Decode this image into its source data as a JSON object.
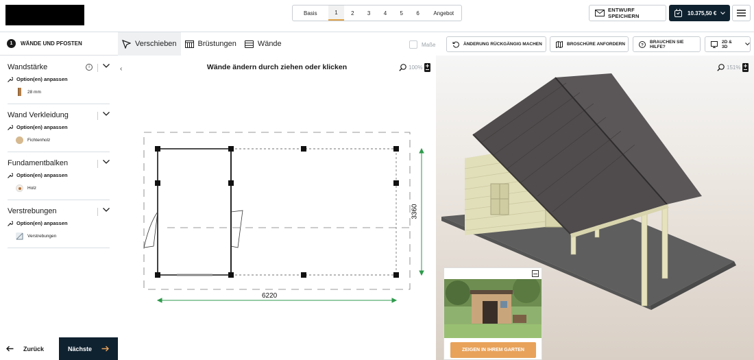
{
  "topbar": {
    "steps": [
      {
        "label": "Basis"
      },
      {
        "label": "1"
      },
      {
        "label": "2"
      },
      {
        "label": "3"
      },
      {
        "label": "4"
      },
      {
        "label": "5"
      },
      {
        "label": "6"
      },
      {
        "label": "Angebot"
      }
    ],
    "active_step": "1",
    "save_label": "ENTWURF SPEICHERN",
    "price_label": "10.375,50 €"
  },
  "stepbar": {
    "number": "1",
    "title": "WÄNDE UND PFOSTEN"
  },
  "tabs": [
    {
      "label": "Verschieben",
      "icon": "cursor-icon",
      "active": true
    },
    {
      "label": "Brüstungen",
      "icon": "railing-icon",
      "active": false
    },
    {
      "label": "Wände",
      "icon": "wall-icon",
      "active": false
    }
  ],
  "tools": {
    "masse_label": "Maße",
    "undo_label": "ÄNDERUNG RÜCKGÄNGIG MACHEN",
    "brochure_label": "BROSCHÜRE ANFORDERN",
    "help_label": "BRAUCHEN SIE HILFE?",
    "view_mode_label": "2D & 3D"
  },
  "sidebar": {
    "sections": [
      {
        "title": "Wandstärke",
        "option_label": "Option(en) anpassen",
        "value": "28 mm",
        "has_info": true
      },
      {
        "title": "Wand Verkleidung",
        "option_label": "Option(en) anpassen",
        "value": "Fichtenholz",
        "has_info": false
      },
      {
        "title": "Fundamentbalken",
        "option_label": "Option(en) anpassen",
        "value": "Holz",
        "has_info": false
      },
      {
        "title": "Verstrebungen",
        "option_label": "Option(en) anpassen",
        "value": "Verstrebungen",
        "has_info": false
      }
    ]
  },
  "plan": {
    "title": "Wände ändern durch ziehen oder klicken",
    "zoom": "100%",
    "width_dimension": "6220",
    "depth_dimension": "3360"
  },
  "view3d": {
    "zoom": "151%",
    "garden_button": "ZEIGEN IN IHREM GARTEN"
  },
  "nav": {
    "back_label": "Zurück",
    "next_label": "Nächste"
  },
  "colors": {
    "primary_dark": "#0f2230",
    "accent": "#e8a25a",
    "active_underline": "#e2a247"
  }
}
